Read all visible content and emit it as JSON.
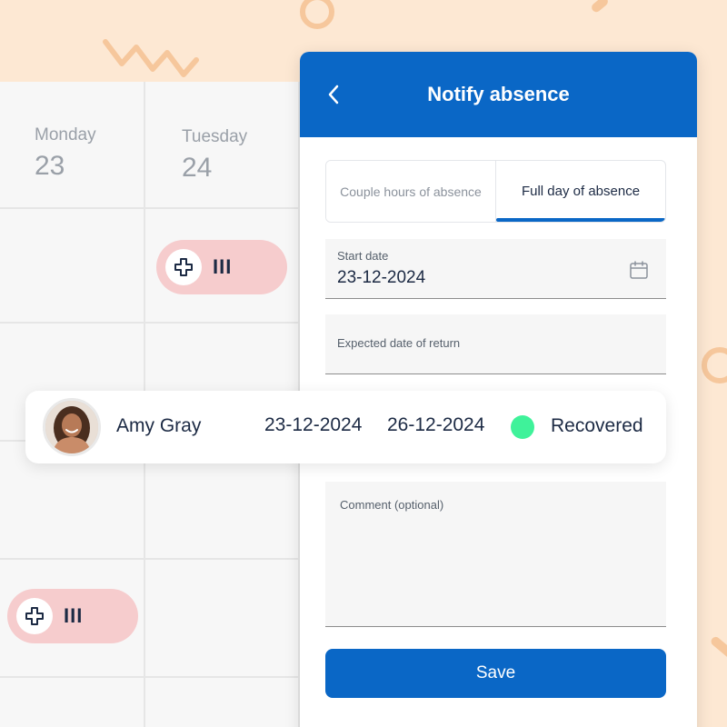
{
  "calendar": {
    "days": [
      {
        "name": "Monday",
        "number": "23"
      },
      {
        "name": "Tuesday",
        "number": "24"
      }
    ],
    "pill_bars": "III"
  },
  "panel": {
    "title": "Notify absence",
    "tabs": [
      {
        "label": "Couple hours of absence",
        "active": false
      },
      {
        "label": "Full day of absence",
        "active": true
      }
    ],
    "start_date": {
      "label": "Start date",
      "value": "23-12-2024"
    },
    "expected_return": {
      "label": "Expected date of return",
      "value": ""
    },
    "comment": {
      "label": "Comment (optional)",
      "value": ""
    },
    "save_label": "Save"
  },
  "absence_row": {
    "name": "Amy Gray",
    "start": "23-12-2024",
    "end": "26-12-2024",
    "status": "Recovered",
    "status_color": "#3ff29a"
  },
  "colors": {
    "accent": "#0a67c6",
    "background": "#fde8d3",
    "pill": "#f6cccd"
  }
}
